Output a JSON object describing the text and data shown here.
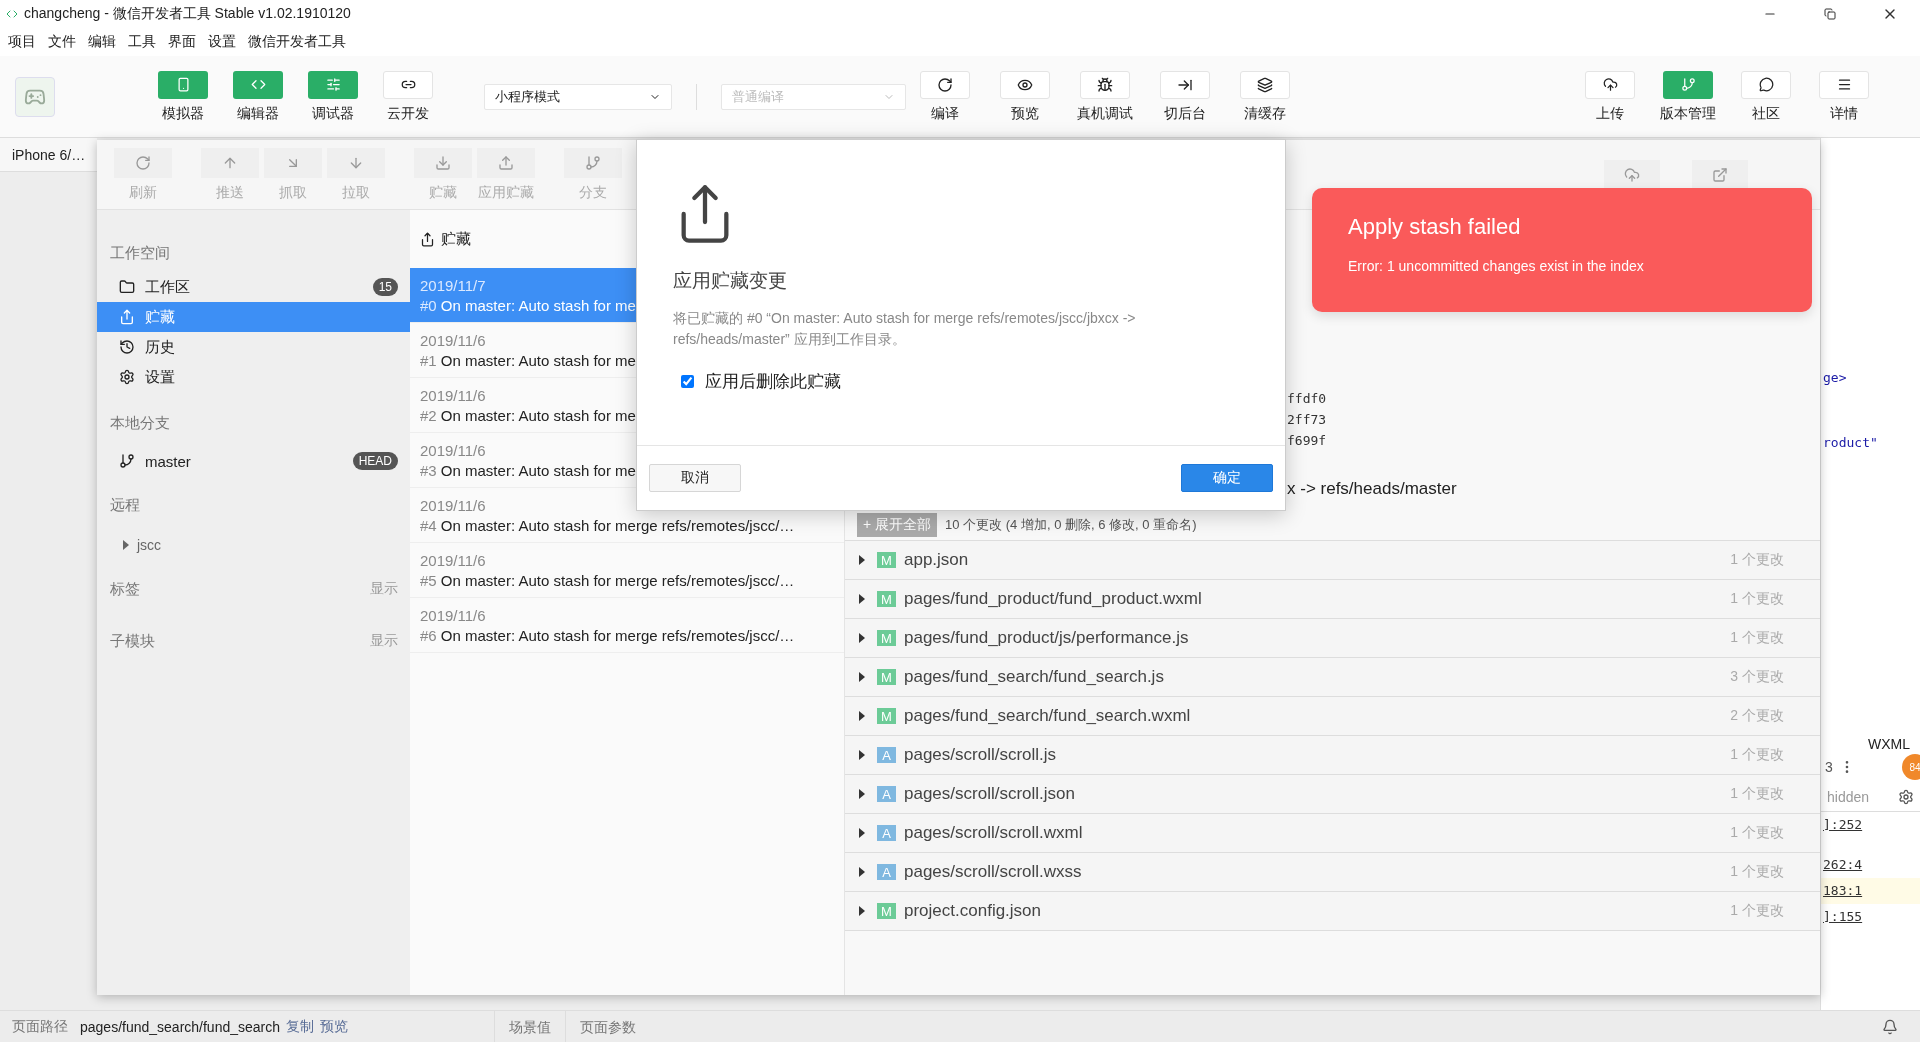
{
  "window": {
    "title": "changcheng - 微信开发者工具 Stable v1.02.1910120"
  },
  "menu": [
    "项目",
    "文件",
    "编辑",
    "工具",
    "界面",
    "设置",
    "微信开发者工具"
  ],
  "toolbar": {
    "views": [
      {
        "label": "模拟器",
        "on": true
      },
      {
        "label": "编辑器",
        "on": true
      },
      {
        "label": "调试器",
        "on": true
      },
      {
        "label": "云开发",
        "on": false
      }
    ],
    "mode": "小程序模式",
    "compile": {
      "value": "普通编译",
      "disabled": true
    },
    "actions": [
      "编译",
      "预览",
      "真机调试",
      "切后台",
      "清缓存"
    ],
    "right": [
      {
        "label": "上传",
        "on": false
      },
      {
        "label": "版本管理",
        "on": true
      },
      {
        "label": "社区",
        "on": false
      },
      {
        "label": "详情",
        "on": false
      }
    ]
  },
  "simulator": {
    "device": "iPhone 6/…"
  },
  "vc": {
    "toolbar": [
      "刷新",
      "推送",
      "抓取",
      "拉取",
      "贮藏",
      "应用贮藏",
      "分支"
    ],
    "sidebar": {
      "workspace_title": "工作空间",
      "workspace": [
        {
          "label": "工作区",
          "badge": "15",
          "selected": false
        },
        {
          "label": "贮藏",
          "selected": true
        },
        {
          "label": "历史",
          "selected": false
        },
        {
          "label": "设置",
          "selected": false
        }
      ],
      "branches_title": "本地分支",
      "branches": [
        {
          "name": "master",
          "badge": "HEAD"
        }
      ],
      "remotes_title": "远程",
      "remotes": [
        {
          "name": "jscc",
          "expanded": false
        }
      ],
      "sections": [
        {
          "label": "标签",
          "action": "显示"
        },
        {
          "label": "子模块",
          "action": "显示"
        }
      ]
    },
    "stash": {
      "title": "贮藏",
      "items": [
        {
          "date": "2019/11/7",
          "index": "#0",
          "message": "On master: Auto stash for me",
          "selected": true
        },
        {
          "date": "2019/11/6",
          "index": "#1",
          "message": "On master: Auto stash for me",
          "selected": false
        },
        {
          "date": "2019/11/6",
          "index": "#2",
          "message": "On master: Auto stash for me",
          "selected": false
        },
        {
          "date": "2019/11/6",
          "index": "#3",
          "message": "On master: Auto stash for me",
          "selected": false
        },
        {
          "date": "2019/11/6",
          "index": "#4",
          "message": "On master: Auto stash for merge refs/remotes/jscc/…",
          "selected": false
        },
        {
          "date": "2019/11/6",
          "index": "#5",
          "message": "On master: Auto stash for merge refs/remotes/jscc/…",
          "selected": false
        },
        {
          "date": "2019/11/6",
          "index": "#6",
          "message": "On master: Auto stash for merge refs/remotes/jscc/…",
          "selected": false
        }
      ]
    },
    "detail": {
      "hashes": [
        "ffdf0",
        "2ff73",
        "f699f"
      ],
      "message": "x -> refs/heads/master",
      "expand_button": "+ 展开全部",
      "summary": "10 个更改 (4 增加, 0 删除, 6 修改, 0 重命名)",
      "files": [
        {
          "status": "M",
          "color": "#6ccb97",
          "path": "app.json",
          "changes": "1 个更改"
        },
        {
          "status": "M",
          "color": "#6ccb97",
          "path": "pages/fund_product/fund_product.wxml",
          "changes": "1 个更改"
        },
        {
          "status": "M",
          "color": "#6ccb97",
          "path": "pages/fund_product/js/performance.js",
          "changes": "1 个更改"
        },
        {
          "status": "M",
          "color": "#6ccb97",
          "path": "pages/fund_search/fund_search.js",
          "changes": "3 个更改"
        },
        {
          "status": "M",
          "color": "#6ccb97",
          "path": "pages/fund_search/fund_search.wxml",
          "changes": "2 个更改"
        },
        {
          "status": "A",
          "color": "#7fb8e0",
          "path": "pages/scroll/scroll.js",
          "changes": "1 个更改"
        },
        {
          "status": "A",
          "color": "#7fb8e0",
          "path": "pages/scroll/scroll.json",
          "changes": "1 个更改"
        },
        {
          "status": "A",
          "color": "#7fb8e0",
          "path": "pages/scroll/scroll.wxml",
          "changes": "1 个更改"
        },
        {
          "status": "A",
          "color": "#7fb8e0",
          "path": "pages/scroll/scroll.wxss",
          "changes": "1 个更改"
        },
        {
          "status": "M",
          "color": "#6ccb97",
          "path": "project.config.json",
          "changes": "1 个更改"
        }
      ]
    }
  },
  "dialog": {
    "title": "应用贮藏变更",
    "message": "将已贮藏的 #0 “On master: Auto stash for merge refs/remotes/jscc/jbxcx -> refs/heads/master” 应用到工作目录。",
    "checkbox": {
      "label": "应用后删除此贮藏",
      "checked": true
    },
    "buttons": [
      {
        "label": "取消",
        "kind": "secondary"
      },
      {
        "label": "确定",
        "kind": "primary"
      }
    ]
  },
  "toast": {
    "title": "Apply stash failed",
    "message": "Error: 1 uncommitted changes exist in the index"
  },
  "editor": {
    "code": [
      "ge>",
      "roduct\""
    ],
    "tab": "WXML",
    "count": "3",
    "badge": "84",
    "filter": "hidden",
    "links": [
      "]:252",
      "262:4",
      "183:1",
      "]:155"
    ]
  },
  "status_bar": {
    "path_label": "页面路径",
    "path": "pages/fund_search/fund_search",
    "links": [
      "复制",
      "预览"
    ],
    "tabs": [
      "场景值",
      "页面参数"
    ]
  }
}
